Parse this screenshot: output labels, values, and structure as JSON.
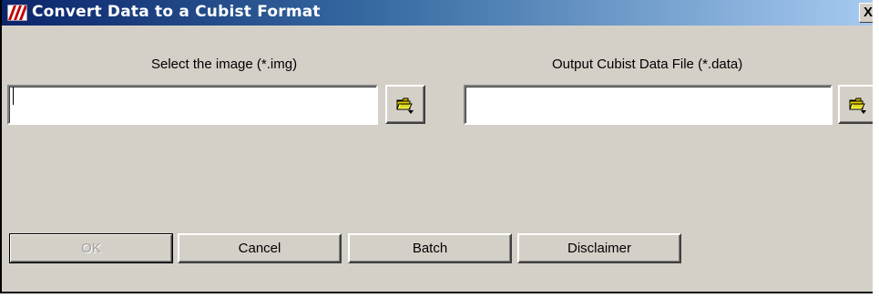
{
  "window": {
    "title": "Convert Data to a Cubist Format",
    "close_glyph": "X"
  },
  "input_image": {
    "label": "Select the image (*.img)",
    "value": "",
    "browse_icon": "folder-open-icon"
  },
  "output_file": {
    "label": "Output Cubist Data File (*.data)",
    "value": "",
    "browse_icon": "folder-open-icon"
  },
  "buttons": {
    "ok": "OK",
    "cancel": "Cancel",
    "batch": "Batch",
    "disclaimer": "Disclaimer"
  },
  "colors": {
    "face": "#d4d0c8",
    "title_gradient_start": "#0a246a",
    "title_gradient_end": "#a6caf0",
    "disabled_text": "#a0a0a0"
  }
}
